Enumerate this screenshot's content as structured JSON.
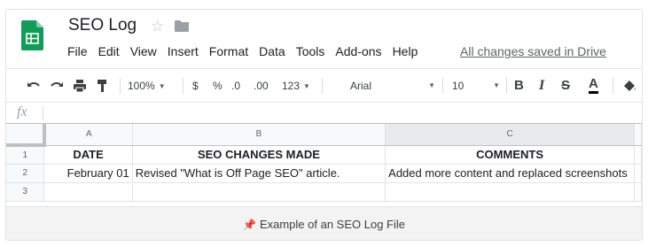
{
  "window": {
    "title": "SEO Log",
    "save_status": "All changes saved in Drive",
    "app_logo_icon": "google-sheets-logo",
    "accent_color": "#0f9d58"
  },
  "menubar": {
    "items": [
      "File",
      "Edit",
      "View",
      "Insert",
      "Format",
      "Data",
      "Tools",
      "Add-ons",
      "Help"
    ]
  },
  "toolbar": {
    "undo_icon": "undo-icon",
    "redo_icon": "redo-icon",
    "print_icon": "print-icon",
    "paint_format_icon": "paint-format-icon",
    "zoom": "100%",
    "currency": "$",
    "percent": "%",
    "decrease_decimal": ".0",
    "increase_decimal": ".00",
    "more_formats": "123",
    "font_family": "Arial",
    "font_size": "10",
    "bold": "B",
    "italic": "I",
    "strikethrough": "S",
    "text_color": "A",
    "fill_color_icon": "paint-bucket-icon"
  },
  "formula_bar": {
    "label": "fx",
    "value": ""
  },
  "sheet": {
    "columns": [
      "A",
      "B",
      "C"
    ],
    "rows": [
      {
        "num": "1",
        "cells": [
          "DATE",
          "SEO CHANGES MADE",
          "COMMENTS"
        ]
      },
      {
        "num": "2",
        "cells": [
          "February 01",
          "Revised \"What is Off Page SEO\" article.",
          "Added more content and replaced screenshots"
        ]
      },
      {
        "num": "3",
        "cells": [
          "",
          "",
          ""
        ]
      }
    ]
  },
  "caption": {
    "text": "Example of an SEO Log File",
    "icon": "pushpin-icon"
  }
}
